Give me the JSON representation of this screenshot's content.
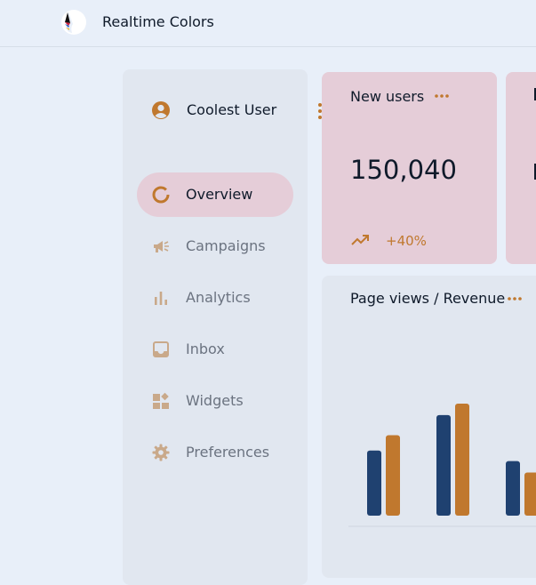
{
  "app": {
    "title": "Realtime Colors"
  },
  "user": {
    "name": "Coolest User"
  },
  "nav": {
    "items": [
      {
        "label": "Overview",
        "icon": "donut-chart-icon",
        "active": true
      },
      {
        "label": "Campaigns",
        "icon": "megaphone-icon",
        "active": false
      },
      {
        "label": "Analytics",
        "icon": "bar-chart-icon",
        "active": false
      },
      {
        "label": "Inbox",
        "icon": "inbox-icon",
        "active": false
      },
      {
        "label": "Widgets",
        "icon": "widgets-icon",
        "active": false
      },
      {
        "label": "Preferences",
        "icon": "gear-icon",
        "active": false
      }
    ]
  },
  "stats": {
    "new_users": {
      "title": "New users",
      "value": "150,040",
      "trend": "+40%"
    }
  },
  "chart_card": {
    "title": "Page views / Revenue"
  },
  "colors": {
    "background": "#e8eff9",
    "accent": "#c0782e",
    "primary": "#1f4170",
    "card_pink": "#e5cdd8",
    "panel": "#e1e7f0",
    "text": "#0f1a2a"
  },
  "chart_data": {
    "type": "bar",
    "categories": [
      "",
      "",
      ""
    ],
    "series": [
      {
        "values": [
          68,
          105,
          57
        ]
      },
      {
        "values": [
          84,
          117,
          45
        ]
      }
    ],
    "ylim": [
      0,
      130
    ],
    "title": "Page views / Revenue",
    "xlabel": "",
    "ylabel": "",
    "grid": false
  }
}
